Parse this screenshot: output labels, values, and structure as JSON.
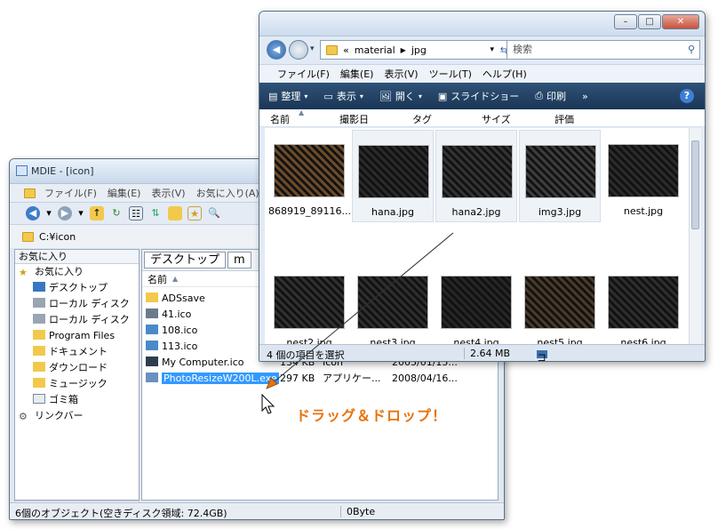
{
  "mdie": {
    "title": "MDIE - [icon]",
    "menu": [
      "ファイル(F)",
      "編集(E)",
      "表示(V)",
      "お気に入り(A)"
    ],
    "address": "C:¥icon",
    "left_header": "お気に入り",
    "tree": [
      {
        "label": "お気に入り",
        "icon": "star-icon"
      },
      {
        "label": "デスクトップ",
        "icon": "desktop-icon"
      },
      {
        "label": "ローカル ディスク",
        "icon": "drive-icon"
      },
      {
        "label": "ローカル ディスク",
        "icon": "drive-icon"
      },
      {
        "label": "Program Files",
        "icon": "folder-icon"
      },
      {
        "label": "ドキュメント",
        "icon": "document-icon"
      },
      {
        "label": "ダウンロード",
        "icon": "folder-icon"
      },
      {
        "label": "ミュージック",
        "icon": "folder-icon"
      },
      {
        "label": "ゴミ箱",
        "icon": "trash-icon"
      },
      {
        "label": "リンクバー",
        "icon": "gear-icon"
      }
    ],
    "tabs": [
      "デスクトップ",
      "m"
    ],
    "col_name": "名前",
    "files": [
      {
        "name": "ADSsave",
        "size": "",
        "type": "",
        "date": "",
        "icon": "folder-icon"
      },
      {
        "name": "41.ico",
        "size": "",
        "type": "",
        "date": "",
        "icon": "ico-file-icon"
      },
      {
        "name": "108.ico",
        "size": "",
        "type": "",
        "date": "",
        "icon": "ico-file-icon"
      },
      {
        "name": "113.ico",
        "size": "",
        "type": "",
        "date": "",
        "icon": "ico-file-icon"
      },
      {
        "name": "My Computer.ico",
        "size": "134 KB",
        "type": "Icon",
        "date": "2005/01/15...",
        "icon": "computer-icon"
      },
      {
        "name": "PhotoResizeW200L.exe",
        "size": "297 KB",
        "type": "アプリケー...",
        "date": "2008/04/16...",
        "icon": "exe-icon"
      }
    ],
    "status_left": "6個のオブジェクト(空きディスク領域: 72.4GB)",
    "status_right": "0Byte"
  },
  "jpg": {
    "address_prefix": "«",
    "address_parts": [
      "material",
      "jpg"
    ],
    "search_placeholder": "検索",
    "menu": [
      "ファイル(F)",
      "編集(E)",
      "表示(V)",
      "ツール(T)",
      "ヘルプ(H)"
    ],
    "toolbar": [
      "整理",
      "表示",
      "開く",
      "スライドショー",
      "印刷"
    ],
    "toolbar_more": "»",
    "columns": [
      "名前",
      "撮影日",
      "タグ",
      "サイズ",
      "評価"
    ],
    "items": [
      {
        "name": "868919_89116...",
        "color": "#6b4a2a"
      },
      {
        "name": "hana.jpg",
        "color": "#2a2a2a"
      },
      {
        "name": "hana2.jpg",
        "color": "#333333"
      },
      {
        "name": "img3.jpg",
        "color": "#3c3c3c"
      },
      {
        "name": "nest.jpg",
        "color": "#2b2b2b"
      },
      {
        "name": "nest2.jpg",
        "color": "#303030"
      },
      {
        "name": "nest3.jpg",
        "color": "#2e2e2e"
      },
      {
        "name": "nest4.jpg",
        "color": "#262626"
      },
      {
        "name": "nest5.jpg",
        "color": "#4a3a2a"
      },
      {
        "name": "nest6.jpg",
        "color": "#2d2d2d"
      }
    ],
    "status_selected": "4 個の項目を選択",
    "status_size": "2.64 MB",
    "status_location": "コンピュータ"
  },
  "overlay": {
    "drag_text": "ドラッグ＆ドロップ！",
    "accent": "#e8720c"
  }
}
